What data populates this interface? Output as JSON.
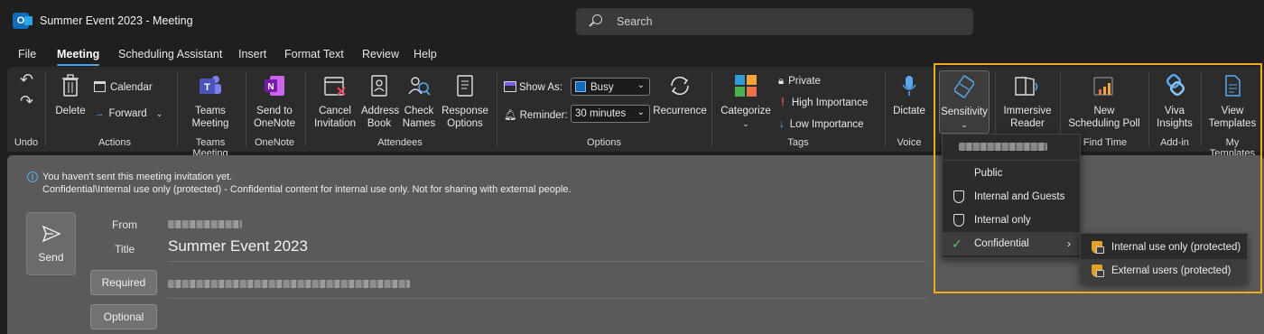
{
  "window": {
    "title": "Summer Event 2023  -  Meeting",
    "app_icon_letter": "O"
  },
  "search": {
    "placeholder": "Search"
  },
  "menu_tabs": [
    "File",
    "Meeting",
    "Scheduling Assistant",
    "Insert",
    "Format Text",
    "Review",
    "Help"
  ],
  "ribbon": {
    "undo": {
      "label": "Undo"
    },
    "actions": {
      "label": "Actions",
      "delete": "Delete",
      "calendar": "Calendar",
      "forward": "Forward"
    },
    "teams": {
      "label": "Teams Meeting",
      "button_line1": "Teams",
      "button_line2": "Meeting"
    },
    "onenote": {
      "label": "OneNote",
      "button_line1": "Send to",
      "button_line2": "OneNote"
    },
    "attendees": {
      "label": "Attendees",
      "cancel_line1": "Cancel",
      "cancel_line2": "Invitation",
      "address_line1": "Address",
      "address_line2": "Book",
      "check_line1": "Check",
      "check_line2": "Names",
      "response_line1": "Response",
      "response_line2": "Options"
    },
    "options": {
      "label": "Options",
      "show_as": "Show As:",
      "show_as_value": "Busy",
      "reminder": "Reminder:",
      "reminder_value": "30 minutes",
      "recurrence": "Recurrence"
    },
    "tags": {
      "label": "Tags",
      "categorize": "Categorize",
      "private": "Private",
      "high": "High Importance",
      "low": "Low Importance"
    },
    "voice": {
      "label": "Voice",
      "dictate": "Dictate"
    },
    "sensitivity": {
      "button": "Sensitivity"
    },
    "immersive": {
      "line1": "Immersive",
      "line2": "Reader"
    },
    "find_time": {
      "label": "Find Time",
      "line1": "New",
      "line2": "Scheduling Poll"
    },
    "addin": {
      "label": "Add-in",
      "line1": "Viva",
      "line2": "Insights"
    },
    "templates": {
      "label": "My Templates",
      "line1": "View",
      "line2": "Templates"
    }
  },
  "info": {
    "line1": "You haven't sent this meeting invitation yet.",
    "line2": "Confidential\\Internal use only (protected) - Confidential content for internal use only. Not for sharing with external people."
  },
  "compose": {
    "send": "Send",
    "from_label": "From",
    "title_label": "Title",
    "subject": "Summer Event 2023",
    "required": "Required",
    "optional": "Optional"
  },
  "sensitivity_menu": {
    "items": [
      "Public",
      "Internal and Guests",
      "Internal only",
      "Confidential"
    ],
    "submenu": [
      "Internal use only (protected)",
      "External users (protected)"
    ]
  },
  "colors": {
    "accent": "#4aa3f0",
    "highlight": "#f0a81c",
    "lock_shield": "#e2a22a"
  }
}
